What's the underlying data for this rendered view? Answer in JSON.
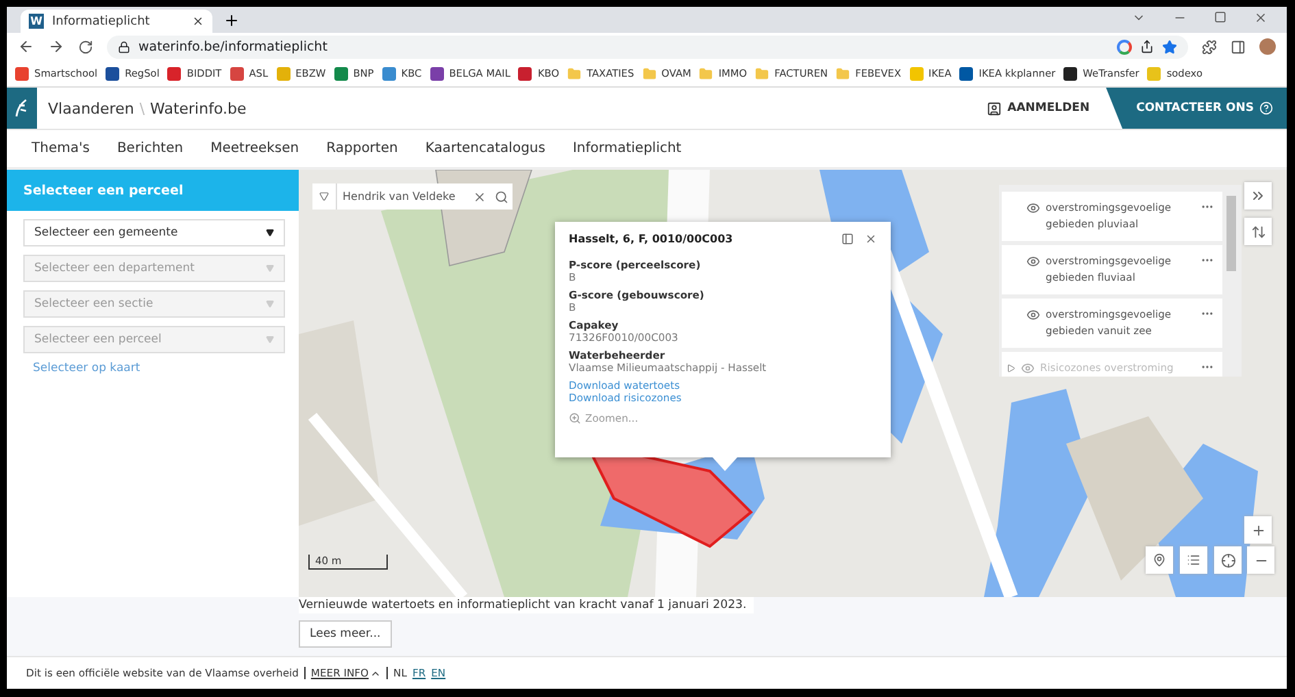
{
  "browser": {
    "tab_favicon": "W",
    "tab_title": "Informatieplicht",
    "url": "waterinfo.be/informatieplicht",
    "bookmarks": [
      {
        "label": "Smartschool",
        "kind": "site",
        "color": "#e8422f"
      },
      {
        "label": "RegSol",
        "kind": "site",
        "color": "#1c4f9c"
      },
      {
        "label": "BIDDIT",
        "kind": "site",
        "color": "#d8232a"
      },
      {
        "label": "ASL",
        "kind": "site",
        "color": "#d64541"
      },
      {
        "label": "EBZW",
        "kind": "site",
        "color": "#e3b10a"
      },
      {
        "label": "BNP",
        "kind": "site",
        "color": "#138a4b"
      },
      {
        "label": "KBC",
        "kind": "site",
        "color": "#3a8ccf"
      },
      {
        "label": "BELGA MAIL",
        "kind": "site",
        "color": "#7a3fa8"
      },
      {
        "label": "KBO",
        "kind": "site",
        "color": "#c8202f"
      },
      {
        "label": "TAXATIES",
        "kind": "folder",
        "color": "#f3c74b"
      },
      {
        "label": "OVAM",
        "kind": "folder",
        "color": "#f3c74b"
      },
      {
        "label": "IMMO",
        "kind": "folder",
        "color": "#f3c74b"
      },
      {
        "label": "FACTUREN",
        "kind": "folder",
        "color": "#f3c74b"
      },
      {
        "label": "FEBEVEX",
        "kind": "folder",
        "color": "#f3c74b"
      },
      {
        "label": "IKEA",
        "kind": "site",
        "color": "#f2c400"
      },
      {
        "label": "IKEA kkplanner",
        "kind": "site",
        "color": "#0058a3"
      },
      {
        "label": "WeTransfer",
        "kind": "site",
        "color": "#222222"
      },
      {
        "label": "sodexo",
        "kind": "site",
        "color": "#e8c21a"
      }
    ]
  },
  "header": {
    "brand": "Vlaanderen",
    "separator": "\\",
    "site": "Waterinfo.be",
    "login": "AANMELDEN",
    "contact": "CONTACTEER ONS"
  },
  "nav": [
    "Thema's",
    "Berichten",
    "Meetreeksen",
    "Rapporten",
    "Kaartencatalogus",
    "Informatieplicht"
  ],
  "sidebar": {
    "title": "Selecteer een perceel",
    "selects": [
      {
        "placeholder": "Selecteer een gemeente",
        "disabled": false
      },
      {
        "placeholder": "Selecteer een departement",
        "disabled": true
      },
      {
        "placeholder": "Selecteer een sectie",
        "disabled": true
      },
      {
        "placeholder": "Selecteer een perceel",
        "disabled": true
      }
    ],
    "map_link": "Selecteer op kaart"
  },
  "map": {
    "search_value": "Hendrik van Veldeke",
    "scale": "40 m",
    "popup": {
      "title": "Hasselt, 6, F, 0010/00C003",
      "fields": [
        {
          "label": "P-score (perceelscore)",
          "value": "B"
        },
        {
          "label": "G-score (gebouwscore)",
          "value": "B"
        },
        {
          "label": "Capakey",
          "value": "71326F0010/00C003"
        },
        {
          "label": "Waterbeheerder",
          "value": "Vlaamse Milieumaatschappij - Hasselt"
        }
      ],
      "links": [
        "Download watertoets",
        "Download risicozones"
      ],
      "zoom": "Zoomen..."
    },
    "layers": [
      {
        "name": "overstromingsgevoelige gebieden pluviaal",
        "active": true,
        "expandable": false
      },
      {
        "name": "overstromingsgevoelige gebieden fluviaal",
        "active": true,
        "expandable": false
      },
      {
        "name": "overstromingsgevoelige gebieden vanuit zee",
        "active": true,
        "expandable": false
      },
      {
        "name": "Risicozones overstroming",
        "active": false,
        "expandable": true
      }
    ]
  },
  "notice": "Vernieuwde watertoets en informatieplicht van kracht vanaf 1 januari 2023.",
  "read_more": "Lees meer...",
  "footer": {
    "text": "Dit is een officiële website van de Vlaamse overheid",
    "more_info": "MEER INFO",
    "languages": [
      {
        "label": "NL",
        "selected": true
      },
      {
        "label": "FR",
        "selected": false
      },
      {
        "label": "EN",
        "selected": false
      }
    ]
  }
}
